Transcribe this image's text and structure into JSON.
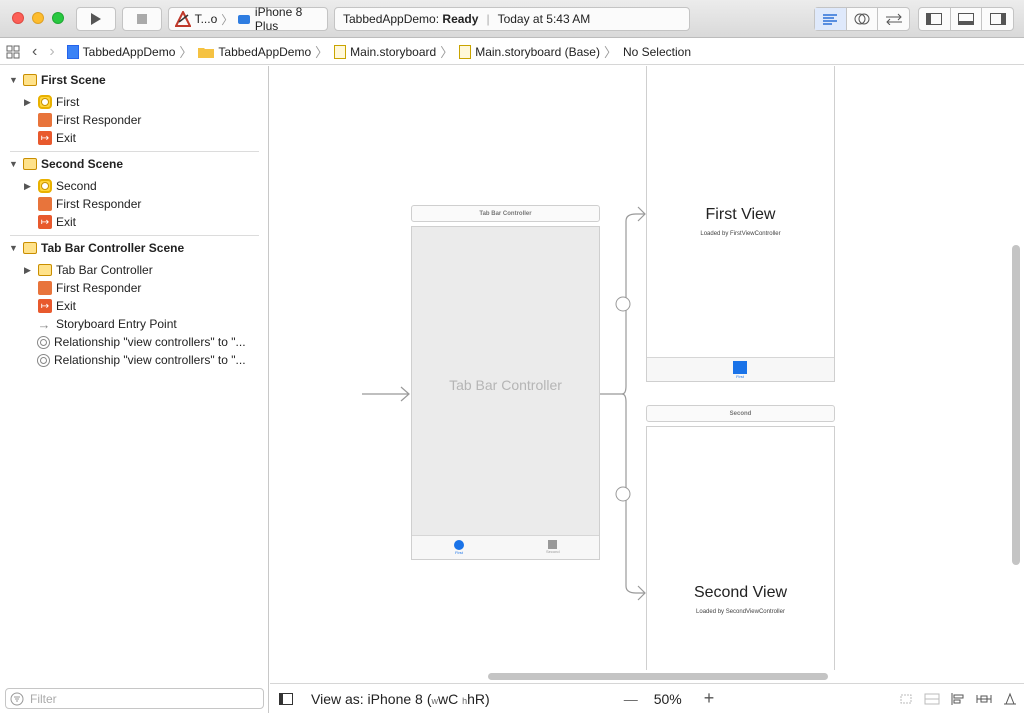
{
  "toolbar": {
    "scheme_name": "T...o",
    "device_name": "iPhone 8 Plus",
    "status_app": "TabbedAppDemo:",
    "status_state": "Ready",
    "status_time": "Today at 5:43 AM"
  },
  "jumpbar": {
    "items": [
      "TabbedAppDemo",
      "TabbedAppDemo",
      "Main.storyboard",
      "Main.storyboard (Base)",
      "No Selection"
    ]
  },
  "outline": {
    "scenes": [
      {
        "title": "First Scene",
        "items": [
          "First",
          "First Responder",
          "Exit"
        ]
      },
      {
        "title": "Second Scene",
        "items": [
          "Second",
          "First Responder",
          "Exit"
        ]
      },
      {
        "title": "Tab Bar Controller Scene",
        "items": [
          "Tab Bar Controller",
          "First Responder",
          "Exit",
          "Storyboard Entry Point",
          "Relationship \"view controllers\" to \"...",
          "Relationship \"view controllers\" to \"..."
        ]
      }
    ],
    "filter_placeholder": "Filter"
  },
  "canvas": {
    "tab_bar_label": "Tab Bar Controller",
    "tab_bar_center": "Tab Bar Controller",
    "tab_first": "First",
    "tab_second": "Second",
    "first_view_title": "First View",
    "first_view_subtitle": "Loaded by FirstViewController",
    "first_tab": "First",
    "second_label": "Second",
    "second_view_title": "Second View",
    "second_view_subtitle": "Loaded by SecondViewController"
  },
  "bottombar": {
    "view_as_label": "View as: iPhone 8",
    "size_class_w": "wC",
    "size_class_h": "hR",
    "minus": "—",
    "zoom": "50%",
    "plus": "+"
  }
}
